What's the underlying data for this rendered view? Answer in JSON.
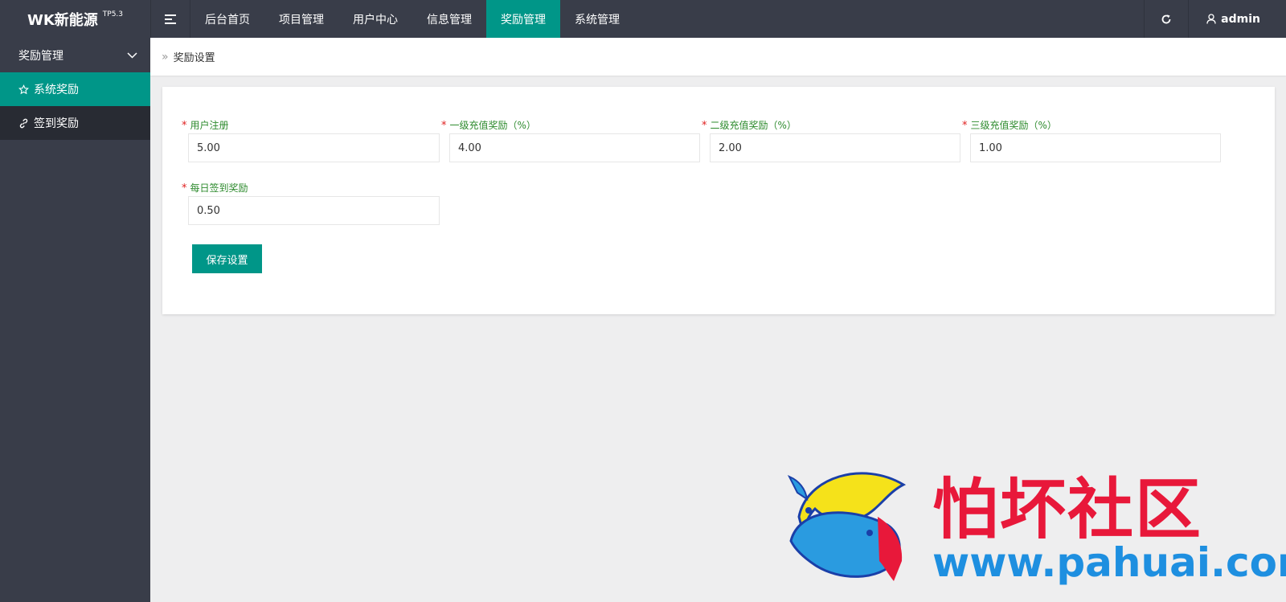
{
  "app": {
    "logo": "WK新能源",
    "version": "TP5.3"
  },
  "topnav": {
    "items": [
      {
        "label": "后台首页"
      },
      {
        "label": "项目管理"
      },
      {
        "label": "用户中心"
      },
      {
        "label": "信息管理"
      },
      {
        "label": "奖励管理",
        "active": true
      },
      {
        "label": "系统管理"
      }
    ],
    "user": "admin"
  },
  "sidebar": {
    "group": "奖励管理",
    "items": [
      {
        "label": "系统奖励",
        "icon": "star-icon",
        "active": true
      },
      {
        "label": "签到奖励",
        "icon": "link-icon"
      }
    ]
  },
  "breadcrumb": {
    "current": "奖励设置"
  },
  "form": {
    "fields": [
      {
        "label": "用户注册",
        "value": "5.00"
      },
      {
        "label": "一级充值奖励（%）",
        "value": "4.00"
      },
      {
        "label": "二级充值奖励（%）",
        "value": "2.00"
      },
      {
        "label": "三级充值奖励（%）",
        "value": "1.00"
      },
      {
        "label": "每日签到奖励",
        "value": "0.50"
      }
    ],
    "required_mark": "*",
    "save_label": "保存设置"
  },
  "watermark": {
    "title": "怕坏社区",
    "url": "www.pahuai.com"
  },
  "colors": {
    "accent": "#009688",
    "dark": "#393d49",
    "label": "#2e8b2e",
    "required": "#e02020"
  }
}
